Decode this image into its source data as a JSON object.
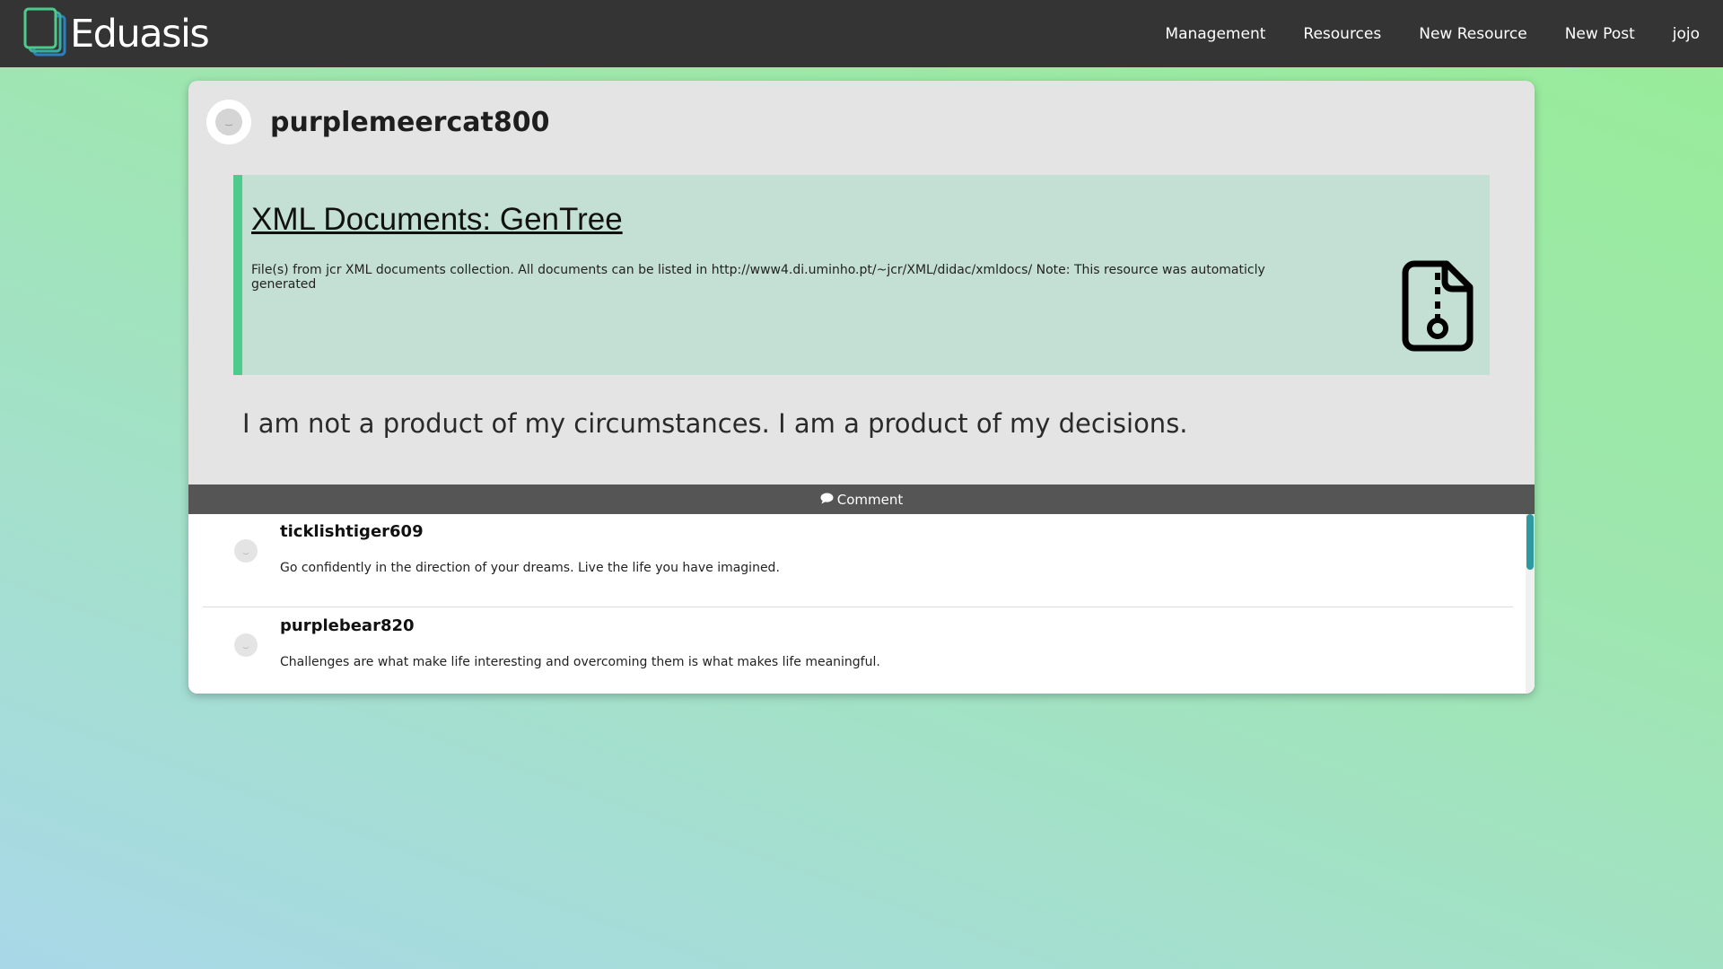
{
  "app": {
    "brand": "Eduasis",
    "logo_icon": "book-stack-logo-icon",
    "colors": {
      "navbar": "#343434",
      "accent": "#4ecb8c",
      "scroll": "#2e9aa0"
    }
  },
  "nav": {
    "items": [
      "Management",
      "Resources",
      "New Resource",
      "New Post",
      "jojo"
    ]
  },
  "post": {
    "author": "purplemeercat800",
    "avatar_icon": "user-avatar-icon",
    "resource": {
      "title": "XML Documents: GenTree",
      "description": "File(s) from jcr XML documents collection. All documents can be listed in http://www4.di.uminho.pt/~jcr/XML/didac/xmldocs/ Note: This resource was automaticly generated",
      "icon": "file-zip-icon"
    },
    "text": "I am not a product of my circumstances. I am a product of my decisions.",
    "comment_label": "Comment",
    "comment_icon": "speech-bubble-icon"
  },
  "comments": [
    {
      "author": "ticklishtiger609",
      "text": "Go confidently in the direction of your dreams. Live the life you have imagined."
    },
    {
      "author": "purplebear820",
      "text": "Challenges are what make life interesting and overcoming them is what makes life meaningful."
    }
  ]
}
